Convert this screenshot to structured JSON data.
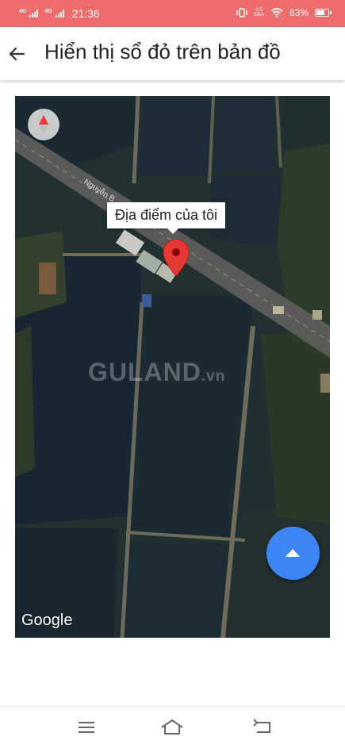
{
  "status_bar": {
    "network_1": "4G",
    "network_2": "4G",
    "time": "21:36",
    "speed_value": "0.5",
    "speed_unit": "KB/s",
    "battery": "63%"
  },
  "header": {
    "title": "Hiển thị sổ đỏ trên bản đồ"
  },
  "map": {
    "road_label": "Nguyễn B",
    "info_window": "Địa điểm của tôi",
    "watermark_main": "GULAND",
    "watermark_suffix": ".vn",
    "attribution": "Google",
    "marker_color": "#e53935",
    "fab_color": "#3f86f5"
  },
  "nav_bar": {
    "icons": [
      "menu-icon",
      "home-icon",
      "back-icon"
    ]
  }
}
